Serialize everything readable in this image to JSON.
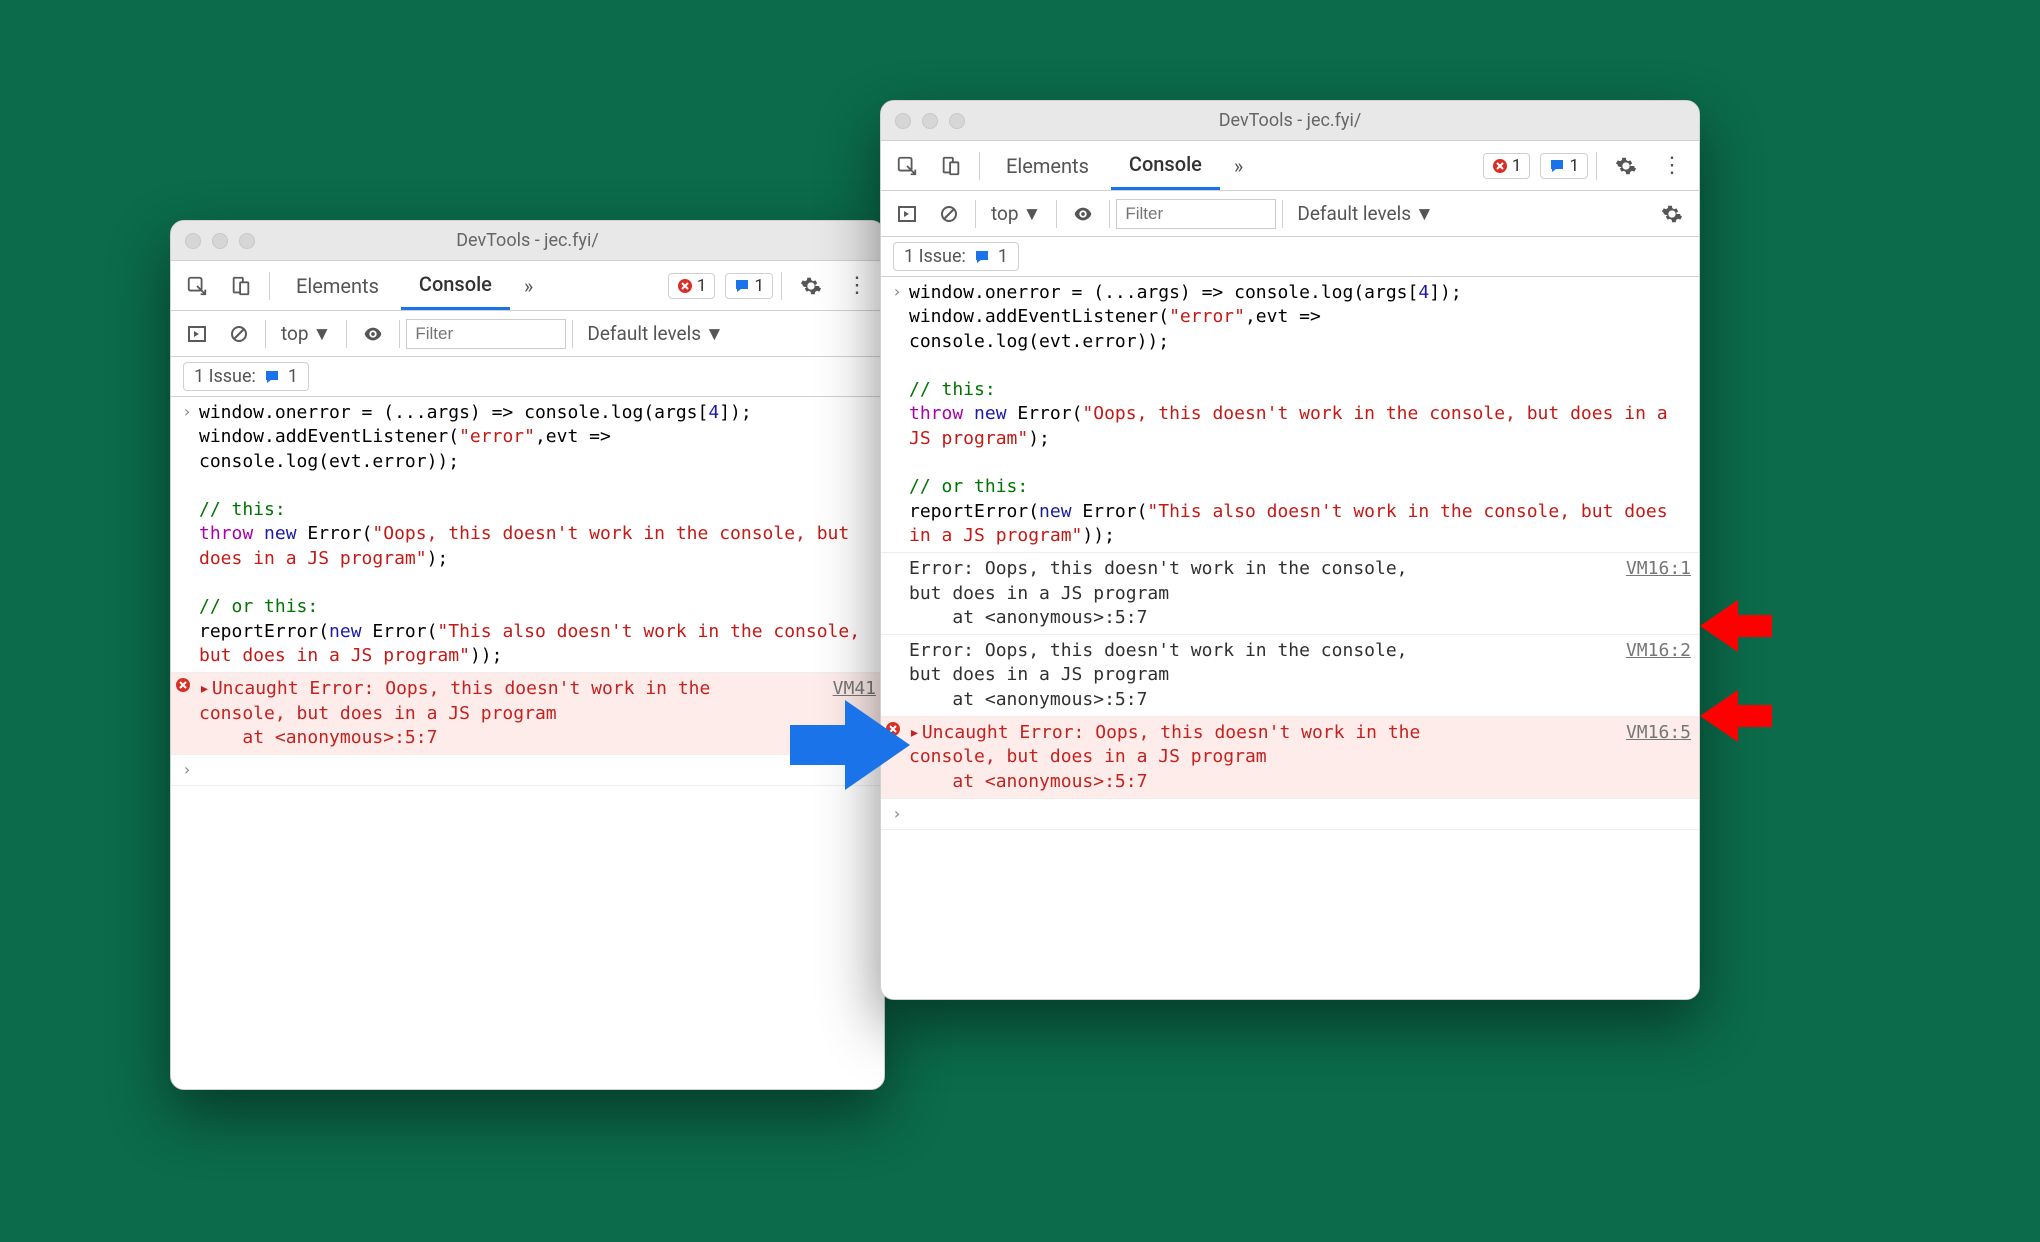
{
  "common": {
    "title": "DevTools - jec.fyi/",
    "tab_elements": "Elements",
    "tab_console": "Console",
    "errors_badge": "1",
    "msgs_badge": "1",
    "top_label": "top",
    "filter_placeholder": "Filter",
    "levels_label": "Default levels",
    "issues_label": "1 Issue:",
    "issues_count": "1",
    "more_tabs": "»"
  },
  "code": {
    "l1a": "window.onerror = (...args) => console.log(args[",
    "l1num": "4",
    "l1b": "]);",
    "l2a": "window.addEventListener(",
    "l2str": "\"error\"",
    "l2b": ",evt =>",
    "l3": "console.log(evt.error));",
    "c1": "// this:",
    "l4a": "throw",
    "l4b": " new",
    "l4c": " Error(",
    "l4str": "\"Oops, this doesn't work in the console, but does in a JS program\"",
    "l4d": ");",
    "c2": "// or this:",
    "l5a": "reportError(",
    "l5b": "new",
    "l5c": " Error(",
    "l5str": "\"This also doesn't work in the console, but does in a JS program\"",
    "l5d": "));"
  },
  "left": {
    "err_line1": "Uncaught Error: Oops, this doesn't work in the",
    "err_line2": "console, but does in a JS program",
    "err_line3": "    at <anonymous>:5:7",
    "err_src": "VM41"
  },
  "right": {
    "log1_l1": "Error: Oops, this doesn't work in the console,",
    "log1_l2": "but does in a JS program",
    "log1_l3": "    at <anonymous>:5:7",
    "log1_src": "VM16:1",
    "log2_l1": "Error: Oops, this doesn't work in the console,",
    "log2_l2": "but does in a JS program",
    "log2_l3": "    at <anonymous>:5:7",
    "log2_src": "VM16:2",
    "err_l1": "Uncaught Error: Oops, this doesn't work in the",
    "err_l2": "console, but does in a JS program",
    "err_l3": "    at <anonymous>:5:7",
    "err_src": "VM16:5"
  }
}
